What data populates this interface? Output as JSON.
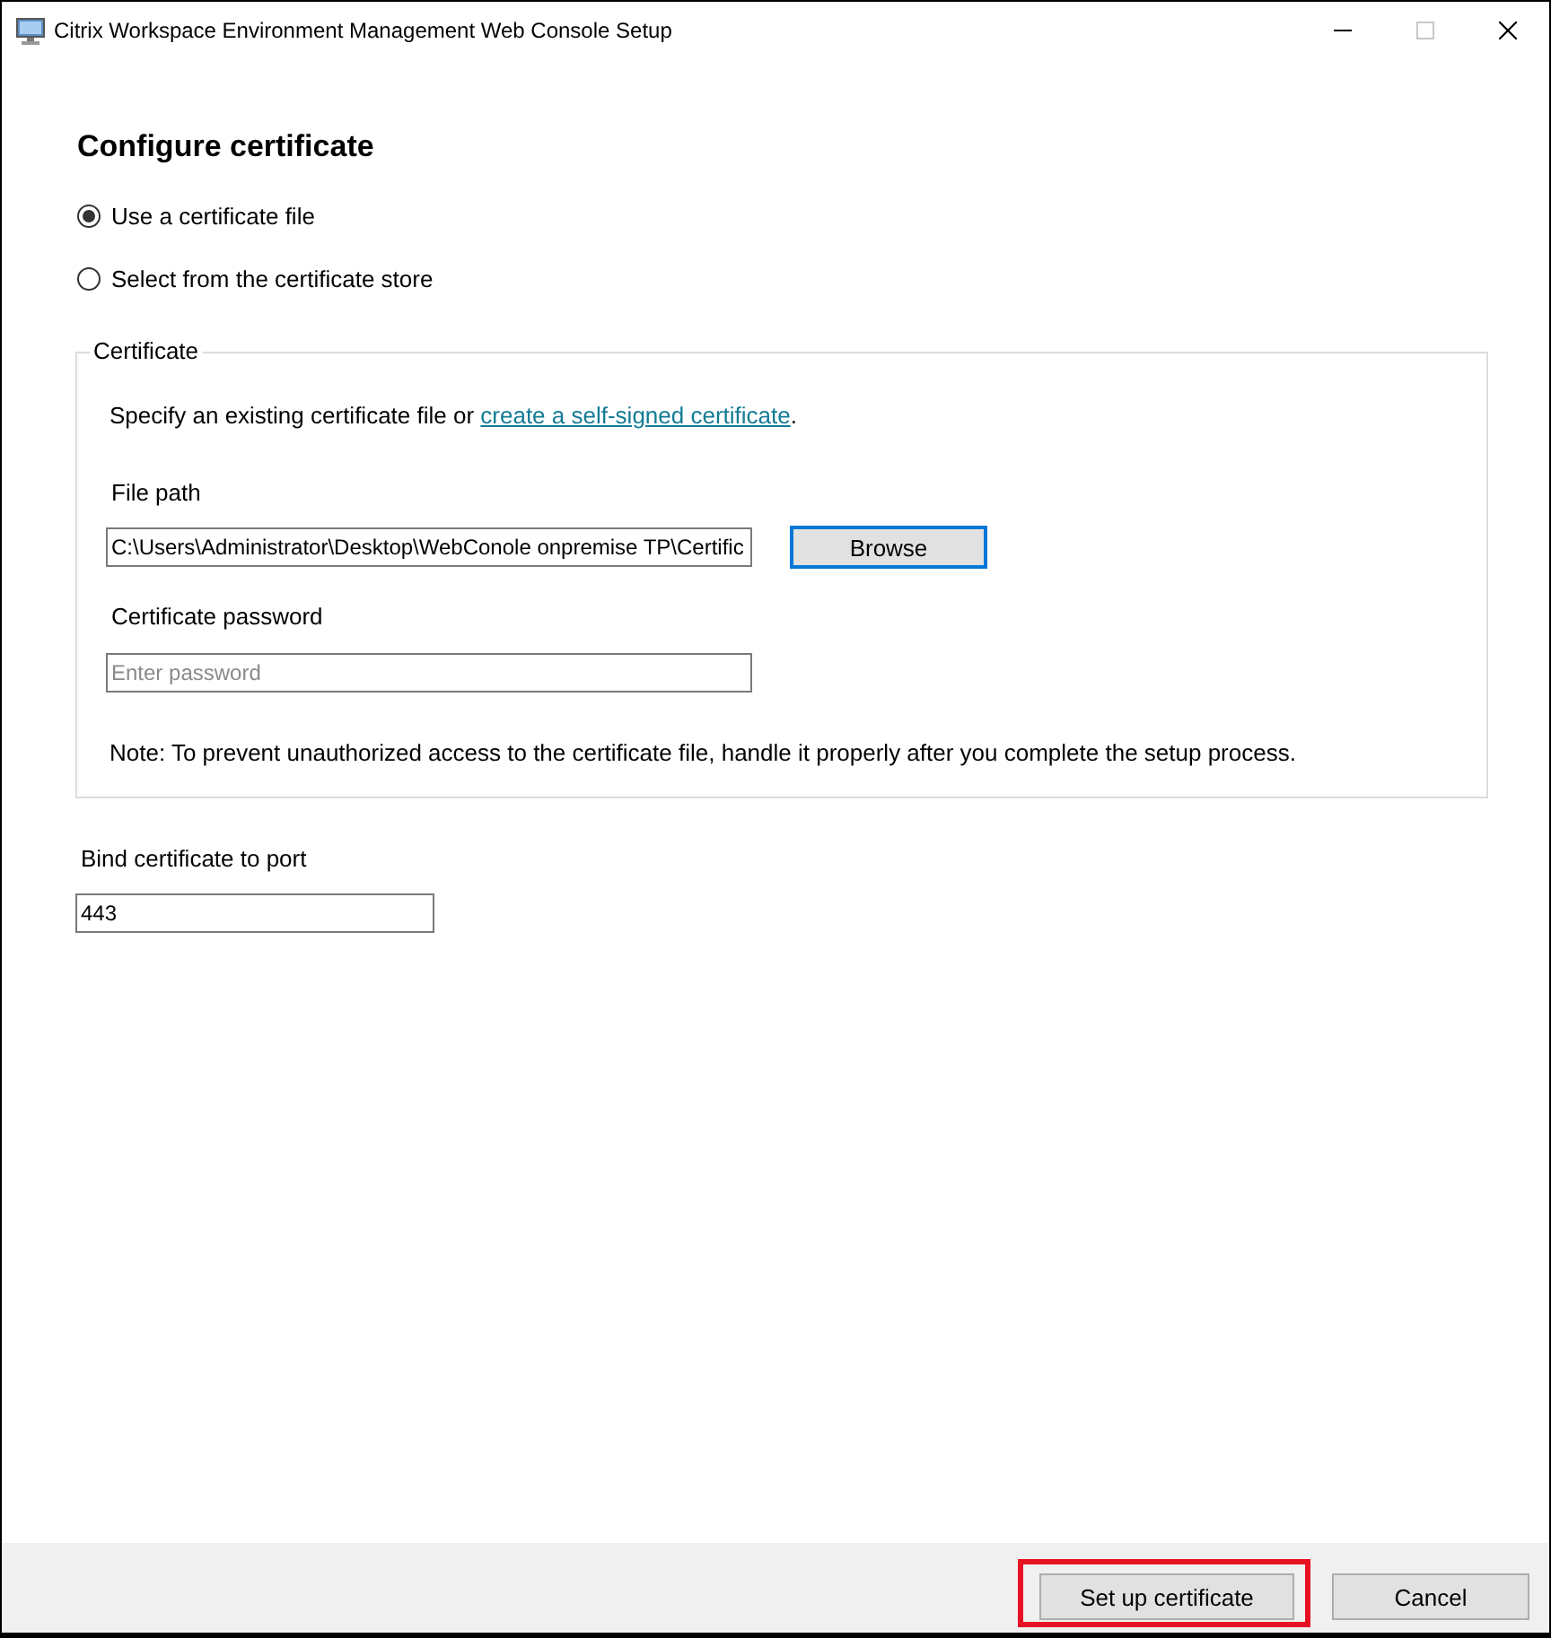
{
  "window": {
    "title": "Citrix Workspace Environment Management Web Console Setup",
    "maximize_disabled": true
  },
  "heading": "Configure certificate",
  "source_options": [
    {
      "label": "Use a certificate file",
      "selected": true
    },
    {
      "label": "Select from the certificate store",
      "selected": false
    }
  ],
  "certificate_group": {
    "title": "Certificate",
    "description": "Specify an existing certificate file or ",
    "link": "create a self-signed certificate",
    "description_end": ".",
    "file_path": {
      "label": "File path",
      "value": "C:\\Users\\Administrator\\Desktop\\WebConole onpremise TP\\Certific"
    },
    "browse_button": {
      "label": "Browse",
      "focused": true
    },
    "password": {
      "label": "Certificate password",
      "placeholder": "Enter password"
    },
    "note": "Note: To prevent unauthorized access to the certificate file, handle it properly after you complete the setup process."
  },
  "port": {
    "label": "Bind certificate to port",
    "value": "443"
  },
  "buttons": [
    {
      "label": "Set up certificate",
      "highlighted": true
    },
    {
      "label": "Cancel",
      "highlighted": false
    }
  ]
}
